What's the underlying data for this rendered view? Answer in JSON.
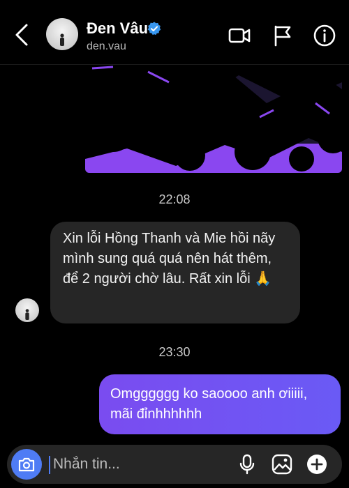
{
  "header": {
    "name": "Đen Vâu",
    "handle": "den.vau",
    "verified": true,
    "icons": [
      "back-icon",
      "video-call-icon",
      "flag-icon",
      "info-icon"
    ]
  },
  "thread": {
    "timestamp_1": "22:08",
    "incoming_message": "Xin lỗi Hồng Thanh và Mie hồi nãy mình sung quá quá nên hát thêm, để 2 người chờ lâu. Rất xin lỗi 🙏",
    "timestamp_2": "23:30",
    "outgoing_message": "Omgggggg ko saoooo anh ơiiiii, mãi đỉnhhhhhh"
  },
  "composer": {
    "placeholder": "Nhắn tin...",
    "icons": [
      "camera-icon",
      "microphone-icon",
      "gallery-icon",
      "plus-icon"
    ]
  },
  "colors": {
    "background": "#000000",
    "incoming_bubble": "#262626",
    "outgoing_bubble": "#7a4cf0",
    "accent_blue": "#4f7cf5",
    "verified_blue": "#3897f0"
  }
}
